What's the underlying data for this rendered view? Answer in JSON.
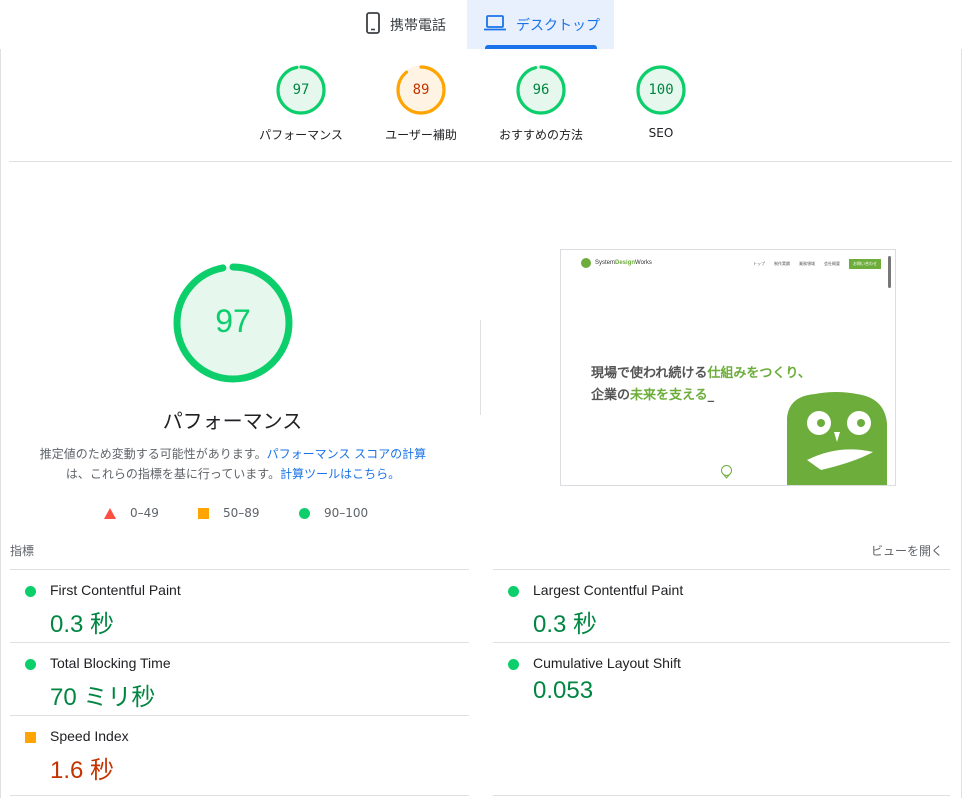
{
  "tabs": {
    "mobile_label": "携帯電話",
    "desktop_label": "デスクトップ",
    "mobile_icon": "smartphone-icon",
    "desktop_icon": "laptop-icon",
    "active": "desktop"
  },
  "categories": [
    {
      "score": "97",
      "label": "パフォーマンス",
      "status": "good"
    },
    {
      "score": "89",
      "label": "ユーザー補助",
      "status": "average"
    },
    {
      "score": "96",
      "label": "おすすめの方法",
      "status": "good"
    },
    {
      "score": "100",
      "label": "SEO",
      "status": "good"
    }
  ],
  "performance": {
    "score": "97",
    "title": "パフォーマンス",
    "desc_prefix": "推定値のため変動する可能性があります。",
    "desc_link1": "パフォーマンス スコアの計算",
    "desc_middle": "は、これらの指標を基に行っています。",
    "desc_link2": "計算ツールはこちら。"
  },
  "legend": {
    "poor": "0–49",
    "average": "50–89",
    "good": "90–100"
  },
  "thumbnail": {
    "logo_text_a": "System",
    "logo_text_b": "Design",
    "logo_text_c": "Works",
    "nav": [
      "トップ",
      "制作実績",
      "業務領域",
      "会社概要"
    ],
    "nav_cta": "お問い合わせ",
    "line1_a": "現場で使われ続ける",
    "line1_b": "仕組みをつくり、",
    "line2_a": "企業の",
    "line2_b": "未来を支える",
    "line2_c": "_"
  },
  "metrics": {
    "heading": "指標",
    "expand_label": "ビューを開く",
    "items": [
      {
        "name": "First Contentful Paint",
        "value": "0.3 秒",
        "status": "good"
      },
      {
        "name": "Largest Contentful Paint",
        "value": "0.3 秒",
        "status": "good"
      },
      {
        "name": "Total Blocking Time",
        "value": "70 ミリ秒",
        "status": "good"
      },
      {
        "name": "Cumulative Layout Shift",
        "value": "0.053",
        "status": "good"
      },
      {
        "name": "Speed Index",
        "value": "1.6 秒",
        "status": "average"
      }
    ]
  },
  "colors": {
    "good": "#0cce6b",
    "good_text": "#008800",
    "average": "#ffa400",
    "average_text": "#c33300",
    "poor": "#ff4e42",
    "accent": "#1a73e8"
  }
}
